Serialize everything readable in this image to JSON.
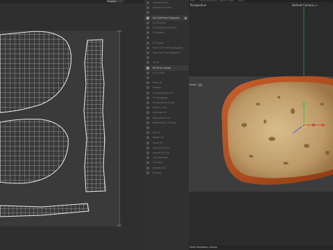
{
  "uv_editor": {
    "dropdown_value": "English",
    "axis_corner_top": "1.0",
    "axis_corner_bottom": "1.0"
  },
  "tool_panel": {
    "items": [
      {
        "label": "Cylindrical UV",
        "header": false
      },
      {
        "label": "Spherical UV Proj",
        "header": false
      },
      {
        "label": "",
        "header": false
      },
      {
        "label": "Set UVW from Projection",
        "header": true,
        "gear": true
      },
      {
        "label": "UV Settings",
        "header": false
      },
      {
        "label": "UV Islands to Camera",
        "header": false
      },
      {
        "label": "UV Islands",
        "header": false
      },
      {
        "label": "",
        "header": false
      },
      {
        "label": "UV Layout",
        "header": false
      },
      {
        "label": "Check UV Overlap Mapping",
        "header": false
      },
      {
        "label": "Copy UVs From Mapping",
        "header": false
      },
      {
        "label": "",
        "header": false
      },
      {
        "label": "Fit UV",
        "header": false
      },
      {
        "label": "Fit UV to Canvas",
        "header": true
      },
      {
        "label": "UV Canvas",
        "header": false
      },
      {
        "label": "",
        "header": false
      },
      {
        "label": "Relax UV",
        "header": false
      },
      {
        "label": "Unwrap",
        "header": false
      },
      {
        "label": "Unwrap Seams UV",
        "header": false
      },
      {
        "label": "UV Straighten",
        "header": false
      },
      {
        "label": "UV Islands to Origin",
        "header": false
      },
      {
        "label": "Align to Grid",
        "header": false
      },
      {
        "label": "Optimize UV",
        "header": false
      },
      {
        "label": "Redistribute UV",
        "header": false
      },
      {
        "label": "Redistribute UV Scale",
        "header": false
      },
      {
        "label": "",
        "header": false
      },
      {
        "label": "Flip UV",
        "header": false
      },
      {
        "label": "Rotate UV",
        "header": false
      },
      {
        "label": "Scale UV",
        "header": false
      },
      {
        "label": "Layout UV Grid",
        "header": false
      },
      {
        "label": "Layout UV Line",
        "header": false
      },
      {
        "label": "Tile Seamless",
        "header": false
      },
      {
        "label": "Tile Shift",
        "header": false
      },
      {
        "label": "Modifier UV",
        "header": false
      },
      {
        "label": "Preview",
        "header": false
      }
    ]
  },
  "viewport": {
    "menu": [
      "View",
      "Cameras",
      "Display",
      "Options",
      "Filter",
      "Panel"
    ],
    "label": "Perspective",
    "camera": "Default Camera ◇·",
    "views_label": "Views",
    "views_value": "0",
    "status": "View Transform: Scene"
  },
  "colors": {
    "crust": "#b5501e",
    "crumb": "#c9ab7a",
    "axis_x": "#e04040",
    "axis_y": "#40c040"
  }
}
